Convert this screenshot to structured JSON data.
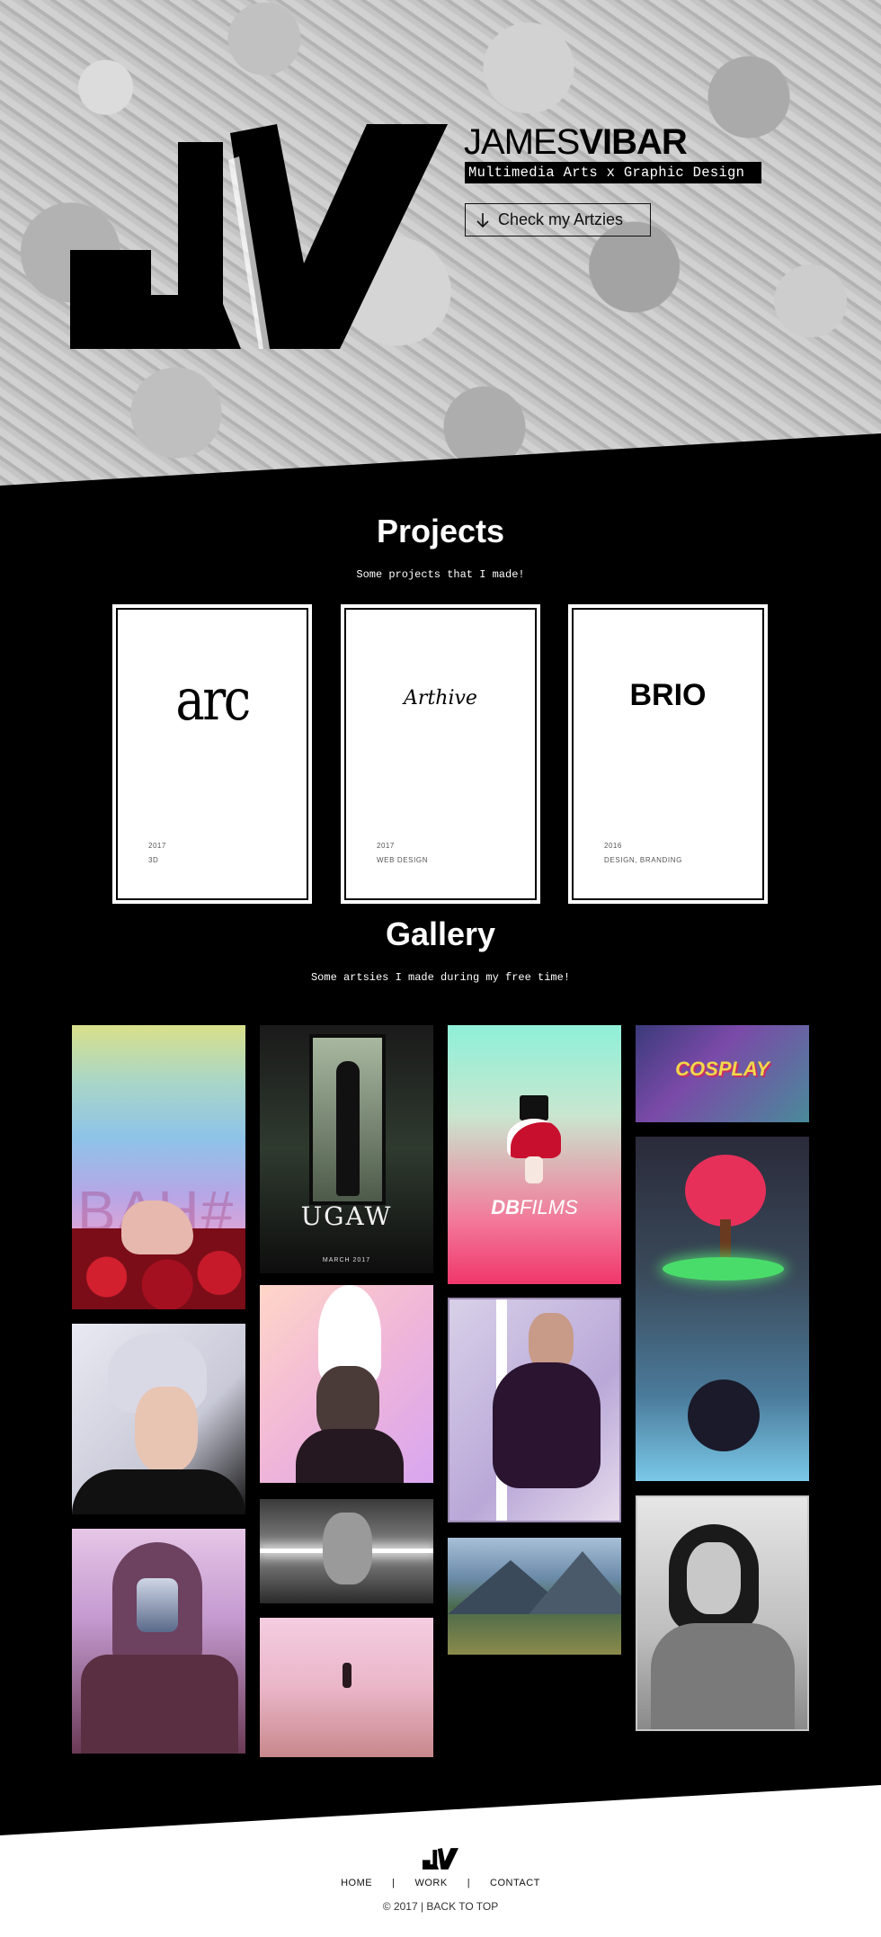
{
  "hero": {
    "name_light": "JAMES",
    "name_bold": "VIBAR",
    "tagline": "Multimedia Arts x Graphic Design",
    "cta_label": "Check my Artzies"
  },
  "projects": {
    "title": "Projects",
    "subtitle": "Some projects that I made!",
    "items": [
      {
        "logo": "arc",
        "year": "2017",
        "tags": "3D"
      },
      {
        "logo": "Arthive",
        "year": "2017",
        "tags": "WEB DESIGN"
      },
      {
        "logo": "BRIO",
        "year": "2016",
        "tags": "DESIGN, BRANDING"
      }
    ]
  },
  "gallery": {
    "title": "Gallery",
    "subtitle": "Some artsies I made during my free time!",
    "poster_text": "UGAW",
    "poster_date": "MARCH 2017",
    "dbfilms_bold": "DB",
    "dbfilms_light": "FILMS",
    "cosplay_text": "COSPLAY",
    "bahay_text": "BAH#"
  },
  "footer": {
    "nav": [
      "HOME",
      "WORK",
      "CONTACT"
    ],
    "separator": "|",
    "copyright": "© 2017 | BACK TO TOP"
  },
  "colors": {
    "background": "#000000",
    "foreground": "#ffffff",
    "accent_pink": "#f0376b",
    "accent_mint": "#8ff0d8"
  }
}
